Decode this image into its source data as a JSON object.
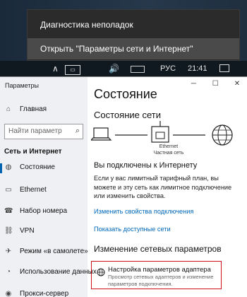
{
  "context_menu": {
    "items": [
      {
        "label": "Диагностика неполадок"
      },
      {
        "label": "Открыть \"Параметры сети и Интернет\""
      }
    ]
  },
  "taskbar": {
    "language": "РУС",
    "time": "21:41",
    "network_icon": "network-icon",
    "volume_icon": "volume-icon",
    "notifications_icon": "notifications-icon"
  },
  "window": {
    "title": "Параметры",
    "home_label": "Главная",
    "search_placeholder": "Найти параметр",
    "section_title": "Сеть и Интернет",
    "nav_items": [
      {
        "label": "Состояние",
        "icon": "globe-icon"
      },
      {
        "label": "Ethernet",
        "icon": "ethernet-icon"
      },
      {
        "label": "Набор номера",
        "icon": "dialup-icon"
      },
      {
        "label": "VPN",
        "icon": "vpn-icon"
      },
      {
        "label": "Режим «в самолете»",
        "icon": "airplane-icon"
      },
      {
        "label": "Использование данных",
        "icon": "data-usage-icon"
      },
      {
        "label": "Прокси-сервер",
        "icon": "proxy-icon"
      }
    ]
  },
  "content": {
    "heading": "Состояние",
    "network_status_heading": "Состояние сети",
    "ethernet_label": "Ethernet",
    "network_type": "Частная сеть",
    "connection_title": "Вы подключены к Интернету",
    "connection_desc": "Если у вас лимитный тарифный план, вы можете и эту сеть как лимитное подключение или изменить свойства.",
    "link_change_props": "Изменить свойства подключения",
    "link_show_networks": "Показать доступные сети",
    "change_heading": "Изменение сетевых параметров",
    "adapter_title": "Настройка параметров адаптера",
    "adapter_desc": "Просмотр сетевых адаптеров и изменение параметров подключения."
  },
  "colors": {
    "accent": "#0067b8",
    "highlight_border": "#d0101a",
    "sidebar_bg": "#eef0f3"
  }
}
